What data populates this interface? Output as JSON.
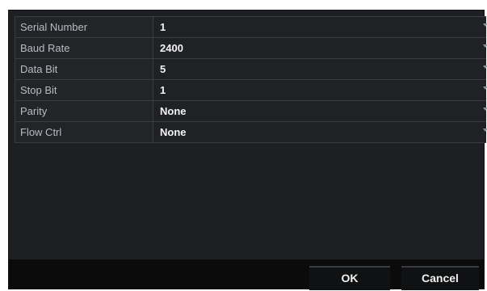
{
  "settings": {
    "rows": [
      {
        "label": "Serial Number",
        "value": "1"
      },
      {
        "label": "Baud Rate",
        "value": "2400"
      },
      {
        "label": "Data Bit",
        "value": "5"
      },
      {
        "label": "Stop Bit",
        "value": "1"
      },
      {
        "label": "Parity",
        "value": "None"
      },
      {
        "label": "Flow Ctrl",
        "value": "None"
      }
    ]
  },
  "actions": {
    "ok_label": "OK",
    "cancel_label": "Cancel"
  },
  "colors": {
    "panel_background": "#1d1f22",
    "footer_background": "#0b0b0c",
    "label_text": "#b9bcc2",
    "value_text": "#f4f4f4"
  },
  "icons": {
    "dropdown": "chevron-down-icon"
  }
}
